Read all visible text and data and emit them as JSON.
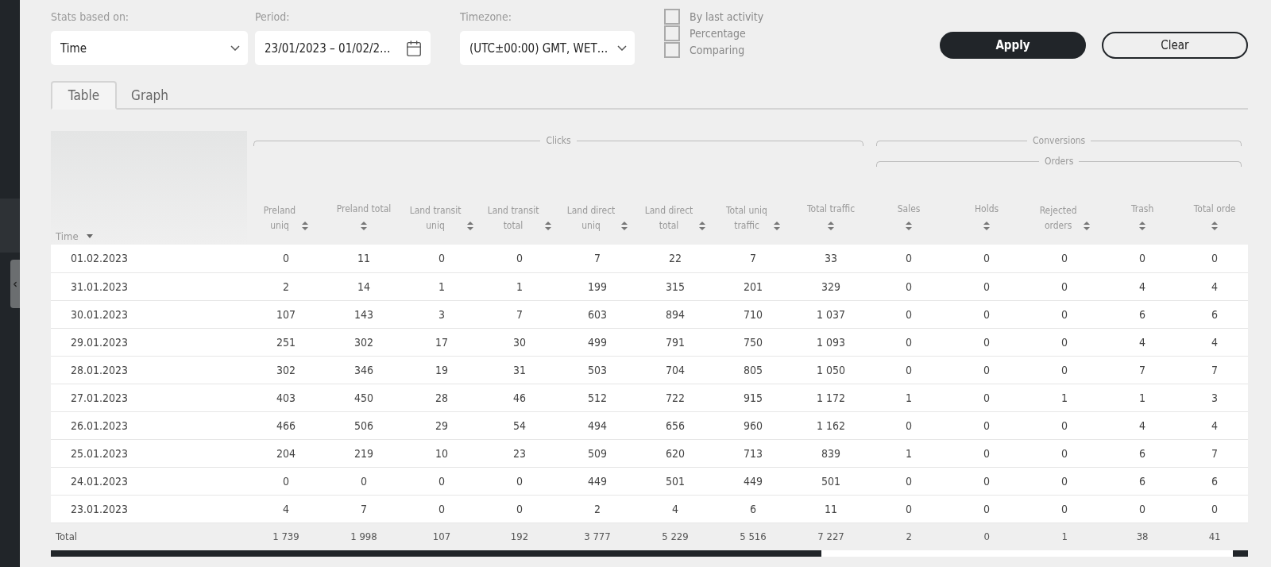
{
  "filters": {
    "stats_based_on": {
      "label": "Stats based on:",
      "value": "Time"
    },
    "period": {
      "label": "Period:",
      "value": "23/01/2023 – 01/02/2…"
    },
    "timezone": {
      "label": "Timezone:",
      "value": "(UTC±00:00) GMT, WET…"
    },
    "checkboxes": [
      {
        "label": "By last activity",
        "checked": false
      },
      {
        "label": "Percentage",
        "checked": false
      },
      {
        "label": "Comparing",
        "checked": false
      }
    ],
    "apply": "Apply",
    "clear": "Clear"
  },
  "tabs": [
    {
      "label": "Table",
      "selected": true
    },
    {
      "label": "Graph",
      "selected": false
    }
  ],
  "table": {
    "time_header": "Time",
    "groups": [
      {
        "label": "Clicks",
        "columns": [
          "Preland\nuniq",
          "Preland total",
          "Land transit\nuniq",
          "Land transit\ntotal",
          "Land direct\nuniq",
          "Land direct\ntotal",
          "Total uniq\ntraffic",
          "Total traffic"
        ]
      },
      {
        "label": "Conversions",
        "subgroups": [
          {
            "label": "Orders",
            "columns": [
              "Sales",
              "Holds",
              "Rejected\norders",
              "Trash",
              "Total orde"
            ]
          }
        ]
      }
    ],
    "rows": [
      {
        "time": "01.02.2023",
        "values": [
          "0",
          "11",
          "0",
          "0",
          "7",
          "22",
          "7",
          "33",
          "0",
          "0",
          "0",
          "0",
          "0"
        ]
      },
      {
        "time": "31.01.2023",
        "values": [
          "2",
          "14",
          "1",
          "1",
          "199",
          "315",
          "201",
          "329",
          "0",
          "0",
          "0",
          "4",
          "4"
        ]
      },
      {
        "time": "30.01.2023",
        "values": [
          "107",
          "143",
          "3",
          "7",
          "603",
          "894",
          "710",
          "1 037",
          "0",
          "0",
          "0",
          "6",
          "6"
        ]
      },
      {
        "time": "29.01.2023",
        "values": [
          "251",
          "302",
          "17",
          "30",
          "499",
          "791",
          "750",
          "1 093",
          "0",
          "0",
          "0",
          "4",
          "4"
        ]
      },
      {
        "time": "28.01.2023",
        "values": [
          "302",
          "346",
          "19",
          "31",
          "503",
          "704",
          "805",
          "1 050",
          "0",
          "0",
          "0",
          "7",
          "7"
        ]
      },
      {
        "time": "27.01.2023",
        "values": [
          "403",
          "450",
          "28",
          "46",
          "512",
          "722",
          "915",
          "1 172",
          "1",
          "0",
          "1",
          "1",
          "3"
        ]
      },
      {
        "time": "26.01.2023",
        "values": [
          "466",
          "506",
          "29",
          "54",
          "494",
          "656",
          "960",
          "1 162",
          "0",
          "0",
          "0",
          "4",
          "4"
        ]
      },
      {
        "time": "25.01.2023",
        "values": [
          "204",
          "219",
          "10",
          "23",
          "509",
          "620",
          "713",
          "839",
          "1",
          "0",
          "0",
          "6",
          "7"
        ]
      },
      {
        "time": "24.01.2023",
        "values": [
          "0",
          "0",
          "0",
          "0",
          "449",
          "501",
          "449",
          "501",
          "0",
          "0",
          "0",
          "6",
          "6"
        ]
      },
      {
        "time": "23.01.2023",
        "values": [
          "4",
          "7",
          "0",
          "0",
          "2",
          "4",
          "6",
          "11",
          "0",
          "0",
          "0",
          "0",
          "0"
        ]
      }
    ],
    "total": {
      "label": "Total",
      "values": [
        "1 739",
        "1 998",
        "107",
        "192",
        "3 777",
        "5 229",
        "5 516",
        "7 227",
        "2",
        "0",
        "1",
        "38",
        "41"
      ]
    }
  }
}
